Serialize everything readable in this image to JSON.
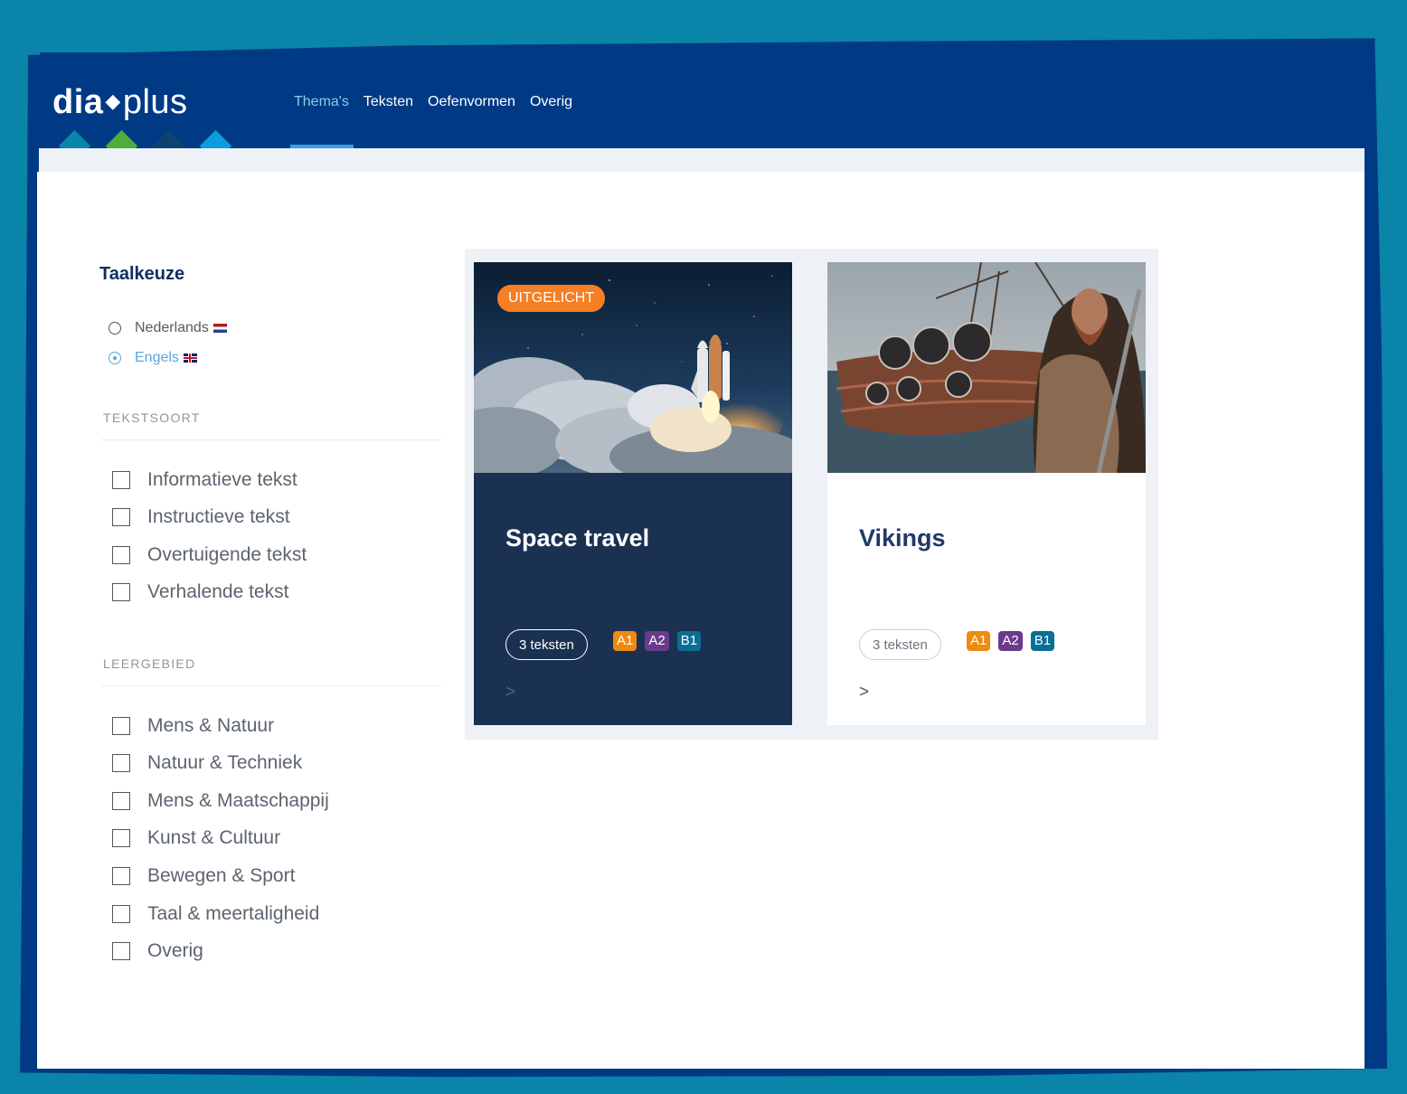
{
  "header": {
    "logo": {
      "dia": "dia",
      "plus": "plus"
    },
    "nav": [
      "Thema's",
      "Teksten",
      "Oefenvormen",
      "Overig"
    ],
    "active_nav": "Thema's",
    "diamond_colors": [
      "#0a84a8",
      "#4fae3b",
      "#0d4372",
      "#0d9ce0"
    ]
  },
  "sidebar": {
    "language_title": "Taalkeuze",
    "languages": [
      {
        "label": "Nederlands",
        "checked": false
      },
      {
        "label": "Engels",
        "checked": true
      }
    ],
    "text_type_title": "TEKSTSOORT",
    "text_types": [
      "Informatieve tekst",
      "Instructieve tekst",
      "Overtuigende tekst",
      "Verhalende tekst"
    ],
    "subject_title": "LEERGEBIED",
    "subjects": [
      "Mens & Natuur",
      "Natuur & Techniek",
      "Mens & Maatschappij",
      "Kunst & Cultuur",
      "Bewegen & Sport",
      "Taal & meertaligheid",
      "Overig"
    ]
  },
  "cards": [
    {
      "title": "Space travel",
      "featured_label": "UITGELICHT",
      "texts_count": "3 teksten",
      "levels": [
        "A1",
        "A2",
        "B1"
      ],
      "arrow": ">"
    },
    {
      "title": "Vikings",
      "texts_count": "3 teksten",
      "levels": [
        "A1",
        "A2",
        "B1"
      ],
      "arrow": ">"
    }
  ],
  "level_colors": {
    "A1": "#ef8a10",
    "A2": "#6b3a8e",
    "B1": "#0a6e96"
  }
}
